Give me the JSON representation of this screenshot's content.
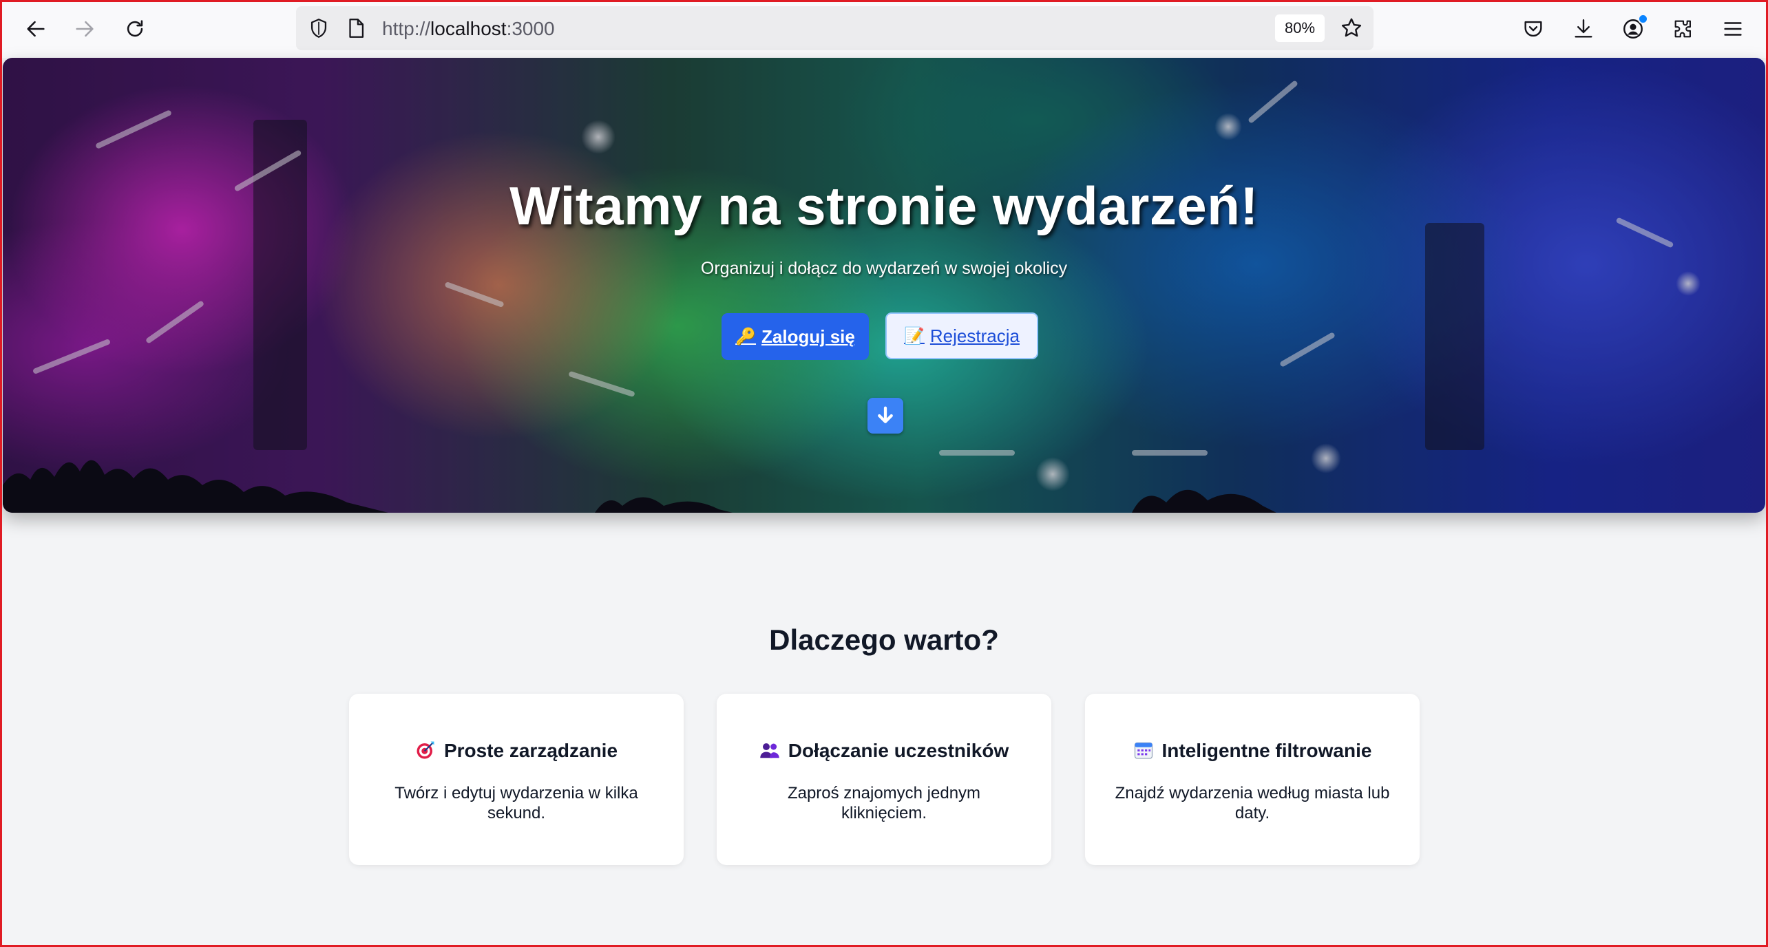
{
  "browser": {
    "url_prefix": "http://",
    "url_host": "localhost",
    "url_port": ":3000",
    "zoom": "80%",
    "icons": [
      "back-icon",
      "forward-icon",
      "reload-icon",
      "shield-icon",
      "page-icon",
      "bookmark-star-icon",
      "pocket-icon",
      "download-icon",
      "account-icon",
      "extensions-icon",
      "menu-icon"
    ]
  },
  "hero": {
    "title": "Witamy na stronie wydarzeń!",
    "subtitle": "Organizuj i dołącz do wydarzeń w swojej okolicy",
    "login_icon": "🔑",
    "login_label": "Zaloguj się",
    "register_icon": "📝",
    "register_label": "Rejestracja",
    "scroll_icon": "arrow-down-icon"
  },
  "features": {
    "title": "Dlaczego warto?",
    "cards": [
      {
        "icon": "target-icon",
        "title": "Proste zarządzanie",
        "text": "Twórz i edytuj wydarzenia w kilka sekund."
      },
      {
        "icon": "people-icon",
        "title": "Dołączanie uczestników",
        "text": "Zaproś znajomych jednym kliknięciem."
      },
      {
        "icon": "calendar-icon",
        "title": "Inteligentne filtrowanie",
        "text": "Znajdź wydarzenia według miasta lub daty."
      }
    ]
  },
  "colors": {
    "primary": "#2563eb",
    "page_bg": "#f3f4f6",
    "heading": "#111827",
    "window_border": "#e01b24"
  }
}
